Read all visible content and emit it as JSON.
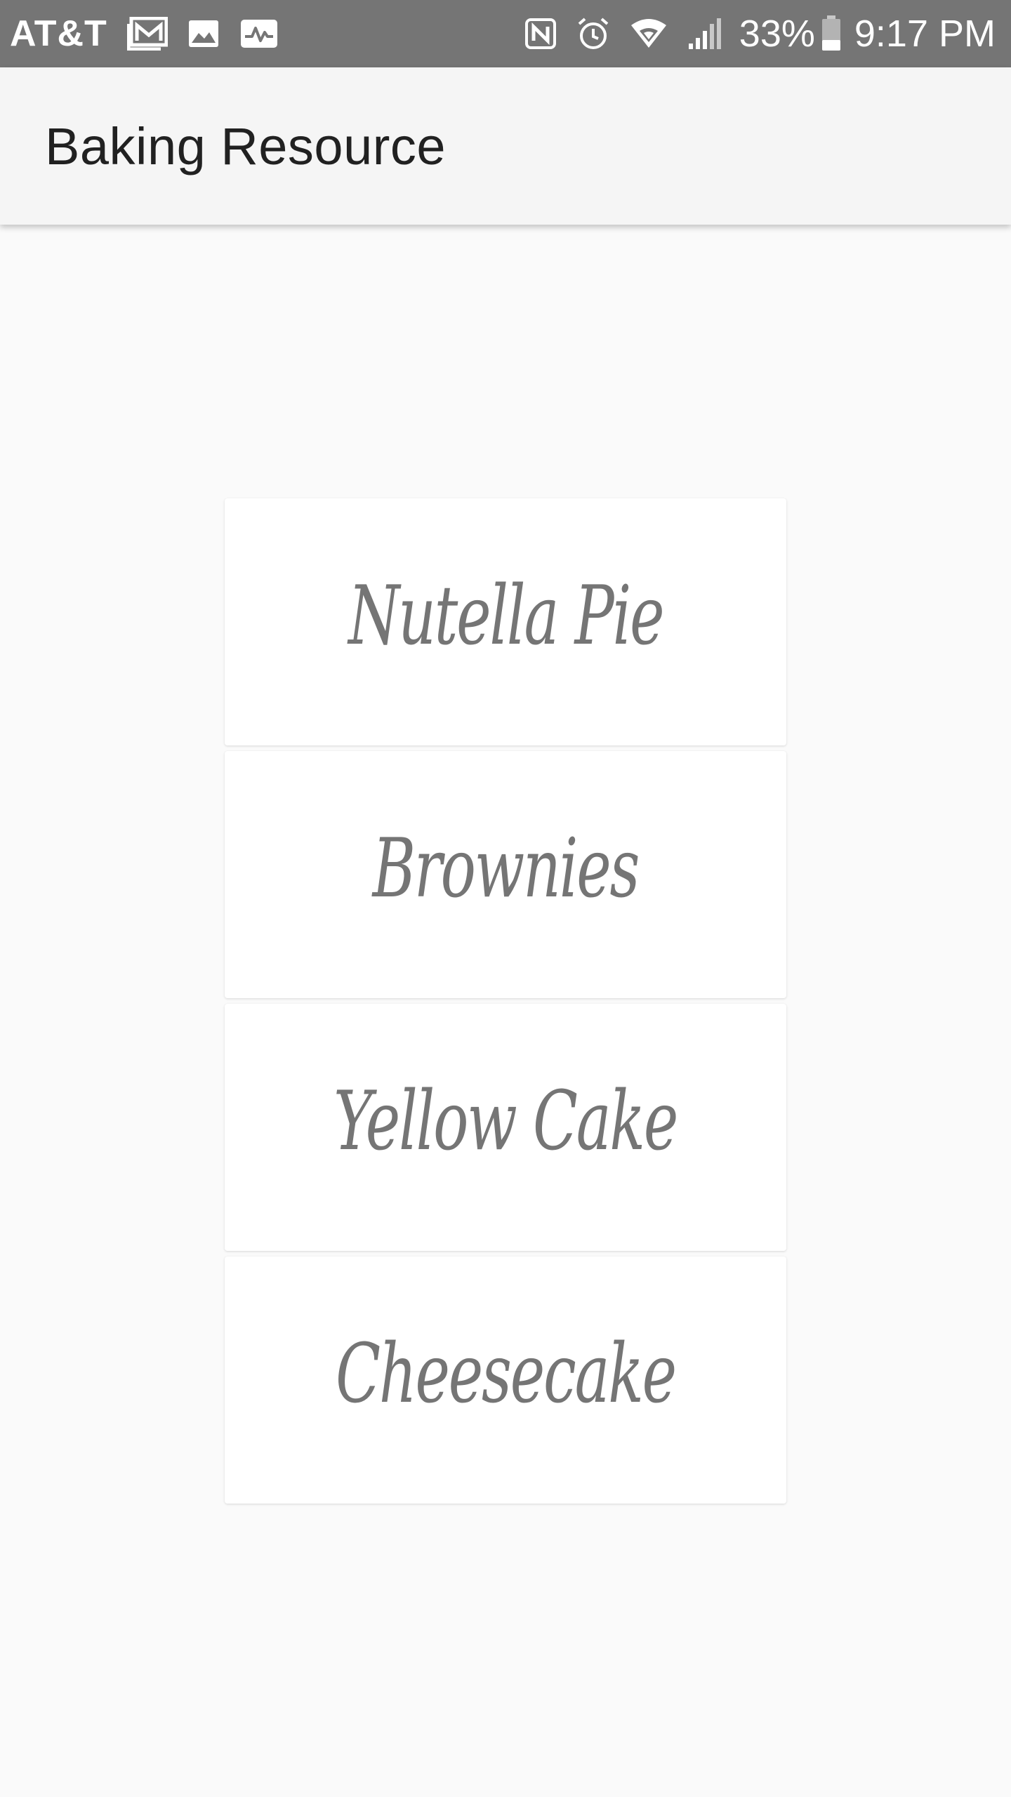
{
  "status_bar": {
    "carrier": "AT&T",
    "left_icons": [
      "gmail-icon",
      "gallery-icon",
      "activity-icon"
    ],
    "right_icons": [
      "nfc-icon",
      "alarm-icon",
      "wifi-icon",
      "signal-icon"
    ],
    "battery_percent": "33%",
    "battery_level": 0.33,
    "time": "9:17 PM",
    "background": "#757575"
  },
  "app_bar": {
    "title": "Baking Resource",
    "background": "#f5f5f5"
  },
  "recipes": [
    {
      "label": "Nutella Pie"
    },
    {
      "label": "Brownies"
    },
    {
      "label": "Yellow Cake"
    },
    {
      "label": "Cheesecake"
    }
  ],
  "colors": {
    "page_background": "#fafafa",
    "card_background": "#ffffff",
    "card_text": "#757575",
    "title_text": "#212121"
  }
}
